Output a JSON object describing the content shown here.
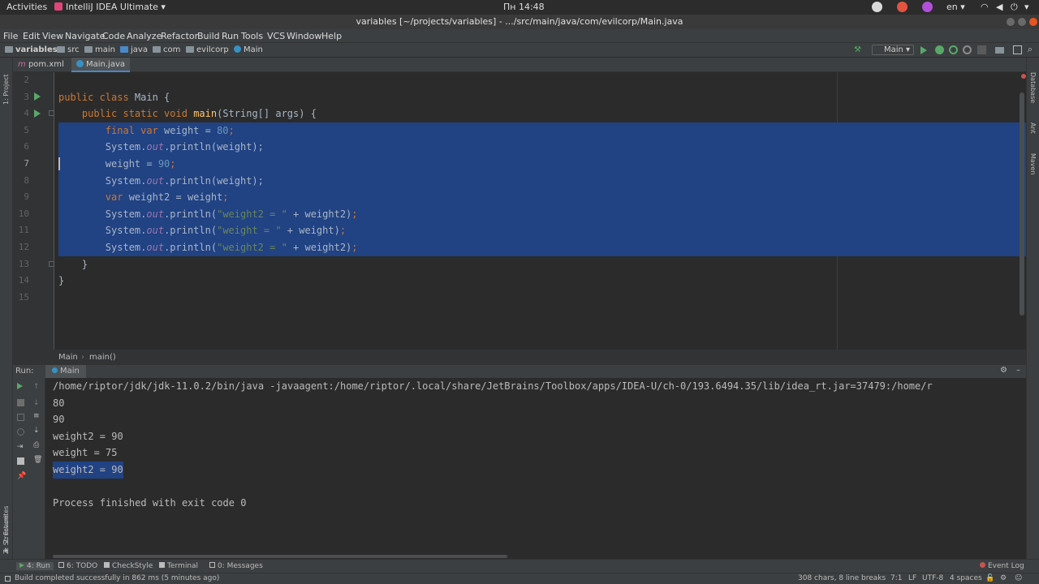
{
  "topbar": {
    "activities": "Activities",
    "app_name": "IntelliJ IDEA Ultimate",
    "clock": "Пн 14:48",
    "lang": "en"
  },
  "window": {
    "title": "variables [~/projects/variables] - .../src/main/java/com/evilcorp/Main.java"
  },
  "menu": [
    "File",
    "Edit",
    "View",
    "Navigate",
    "Code",
    "Analyze",
    "Refactor",
    "Build",
    "Run",
    "Tools",
    "VCS",
    "Window",
    "Help"
  ],
  "breadcrumbs": [
    "variables",
    "src",
    "main",
    "java",
    "com",
    "evilcorp",
    "Main"
  ],
  "run_config": "Main",
  "tabs": [
    {
      "label": "pom.xml",
      "prefix": "m"
    },
    {
      "label": "Main.java",
      "active": true
    }
  ],
  "side_labels": {
    "project": "1: Project",
    "structure": "Z: Structure",
    "favorites": "2: Favorites",
    "database": "Database",
    "ant": "Ant",
    "maven": "Maven"
  },
  "editor": {
    "lines": [
      {
        "n": "2"
      },
      {
        "n": "3"
      },
      {
        "n": "4"
      },
      {
        "n": "5"
      },
      {
        "n": "6"
      },
      {
        "n": "7"
      },
      {
        "n": "8"
      },
      {
        "n": "9"
      },
      {
        "n": "10"
      },
      {
        "n": "11"
      },
      {
        "n": "12"
      },
      {
        "n": "13"
      },
      {
        "n": "14"
      },
      {
        "n": "15"
      }
    ],
    "code": {
      "l3": {
        "kw": "public class ",
        "name": "Main",
        "rest": " {"
      },
      "l4": {
        "kw": "public static void ",
        "fn": "main",
        "rest": "(String[] args) {"
      },
      "l5": {
        "kw": "final var ",
        "a": "weight = ",
        "num": "80",
        "semi": ";"
      },
      "l6": {
        "a": "System.",
        "it": "out",
        "b": ".println(weight);"
      },
      "l7": {
        "a": "weight = ",
        "num": "90",
        "semi": ";"
      },
      "l8": {
        "a": "System.",
        "it": "out",
        "b": ".println(weight);"
      },
      "l9": {
        "kw": "var ",
        "a": "weight2 = weight",
        "semi": ";"
      },
      "l10": {
        "a": "System.",
        "it": "out",
        "b": ".println(",
        "str": "\"weight2 = \"",
        "c": " + weight2)",
        "semi": ";"
      },
      "l11": {
        "a": "System.",
        "it": "out",
        "b": ".println(",
        "str": "\"weight = \"",
        "c": " + weight)",
        "semi": ";"
      },
      "l12": {
        "a": "System.",
        "it": "out",
        "b": ".println(",
        "str": "\"weight2 = \"",
        "c": " + weight2)",
        "semi": ";"
      },
      "l13": "}",
      "l14": "}"
    },
    "crumbs": [
      "Main",
      "main()"
    ]
  },
  "run_panel": {
    "label": "Run:",
    "tab": "Main",
    "console": [
      "/home/riptor/jdk/jdk-11.0.2/bin/java -javaagent:/home/riptor/.local/share/JetBrains/Toolbox/apps/IDEA-U/ch-0/193.6494.35/lib/idea_rt.jar=37479:/home/r",
      "80",
      "90",
      "weight2 = 90",
      "weight = 75",
      "weight2 = 90",
      "",
      "Process finished with exit code 0"
    ]
  },
  "tool_buttons": [
    "4: Run",
    "6: TODO",
    "CheckStyle",
    "Terminal",
    "0: Messages"
  ],
  "event_log": "Event Log",
  "status": {
    "message": "Build completed successfully in 862 ms (5 minutes ago)",
    "chars": "308 chars, 8 line breaks",
    "pos": "7:1",
    "sep": "LF",
    "enc": "UTF-8",
    "indent": "4 spaces"
  },
  "colors": {
    "accent": "#4a88c7",
    "selection": "#214283",
    "run_green": "#59a869"
  }
}
